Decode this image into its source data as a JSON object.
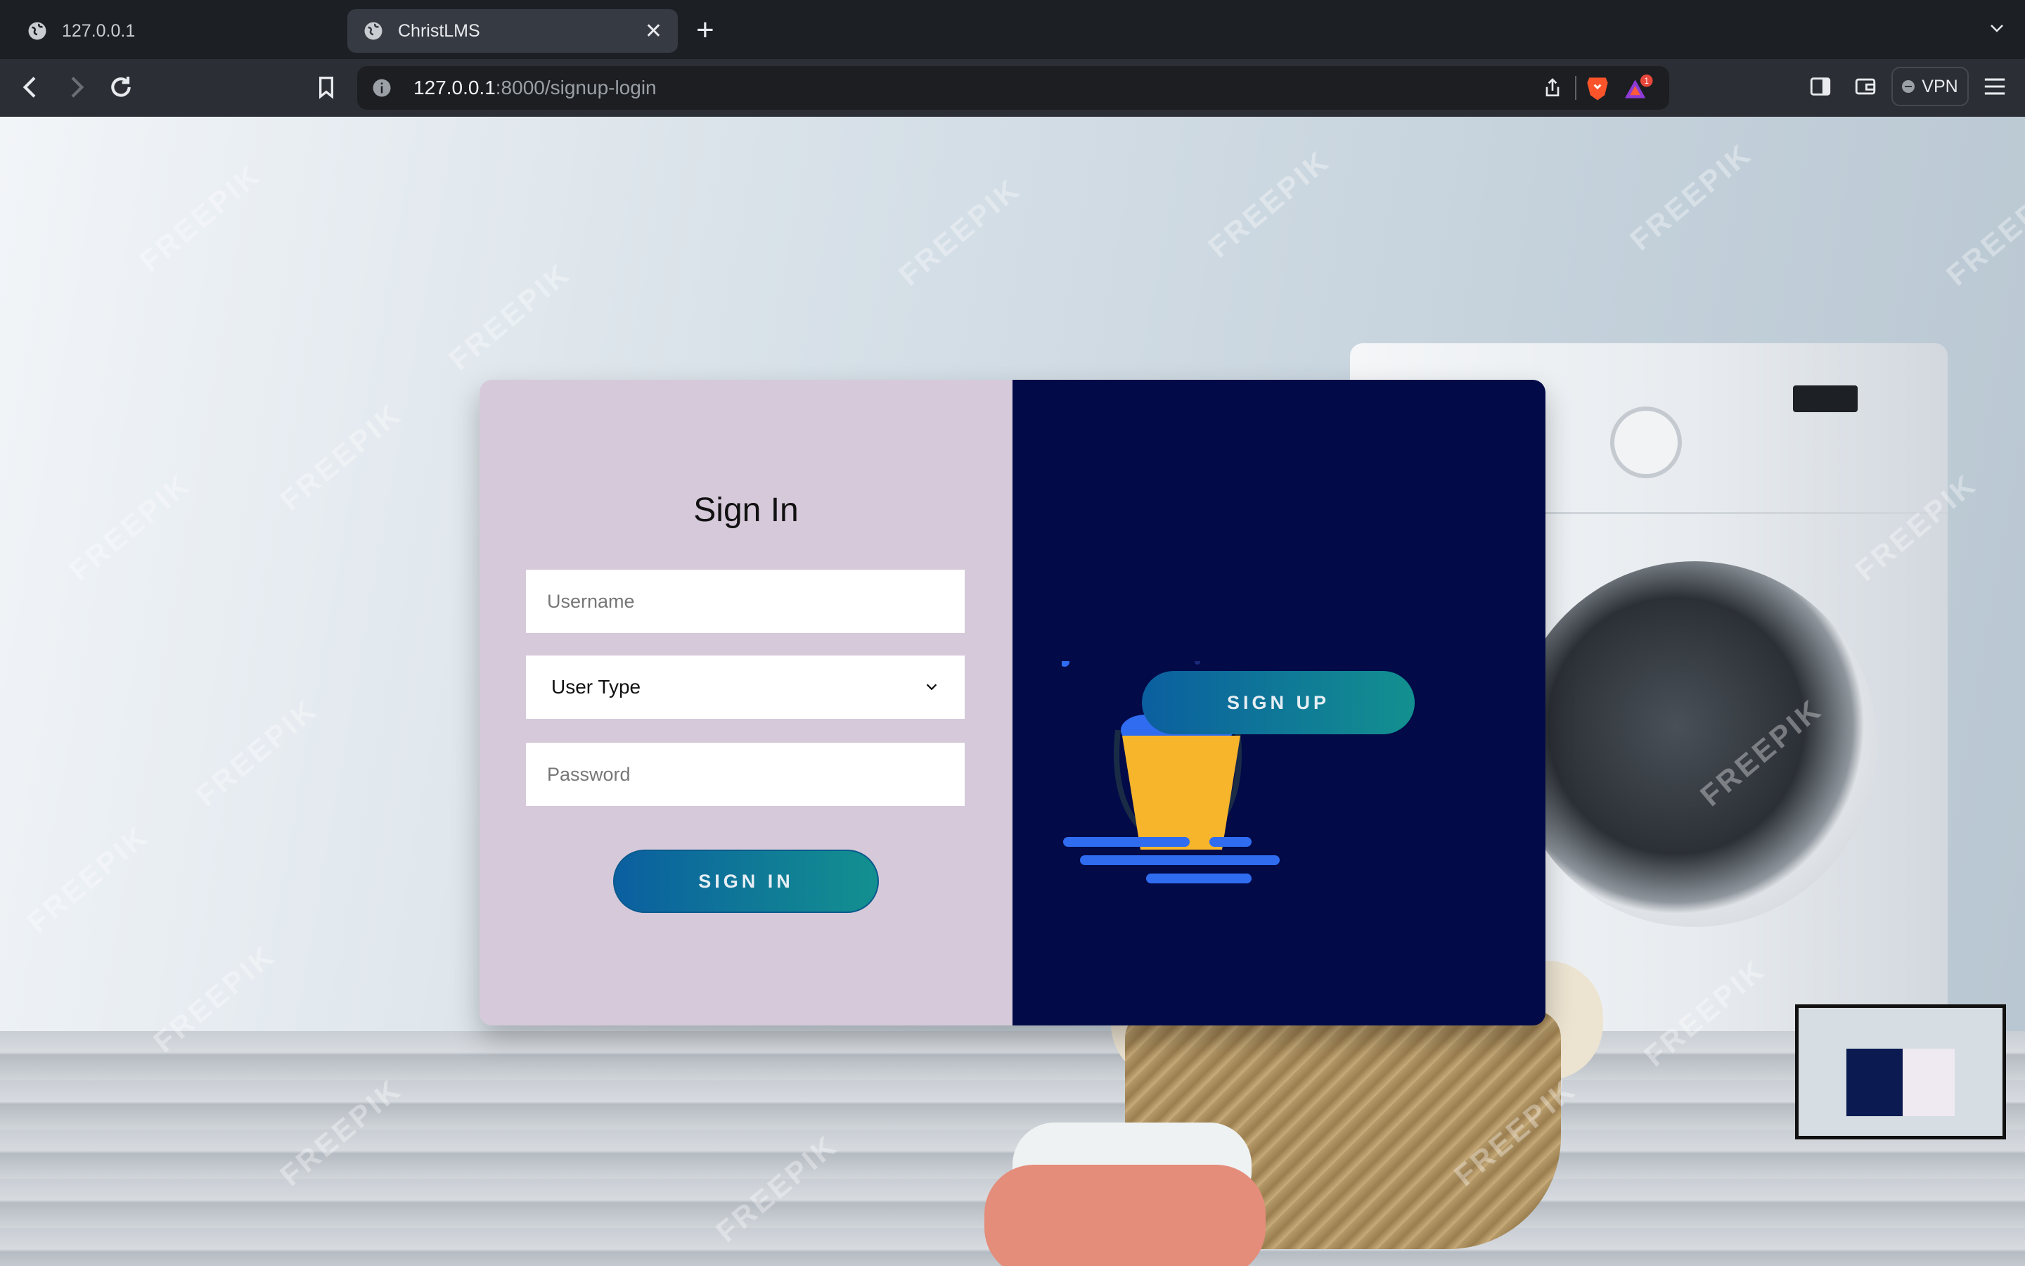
{
  "browser": {
    "tabs": [
      {
        "title": "127.0.0.1",
        "active": false
      },
      {
        "title": "ChristLMS",
        "active": true
      }
    ],
    "new_tab_label": "+",
    "url_host": "127.0.0.1",
    "url_path": ":8000/signup-login",
    "vpn_label": "VPN",
    "rewards_badge": "1",
    "icons": [
      "back-icon",
      "forward-icon",
      "reload-icon",
      "bookmark-icon",
      "site-info-icon",
      "share-icon",
      "brave-shields-icon",
      "brave-rewards-icon",
      "sidebar-icon",
      "wallet-icon",
      "menu-icon",
      "tab-list-icon"
    ]
  },
  "background": {
    "watermark_text": "FREEPIK"
  },
  "signin": {
    "title": "Sign In",
    "username_placeholder": "Username",
    "user_type_selected": "User Type",
    "password_placeholder": "Password",
    "button_label": "SIGN IN"
  },
  "signup_panel": {
    "button_label": "SIGN UP"
  },
  "colors": {
    "left_panel": "#d6c9da",
    "right_panel": "#020a48",
    "button_start": "#0b5fa0",
    "button_end": "#13908f",
    "bucket": "#f7b52c",
    "water": "#2f6cf0"
  }
}
